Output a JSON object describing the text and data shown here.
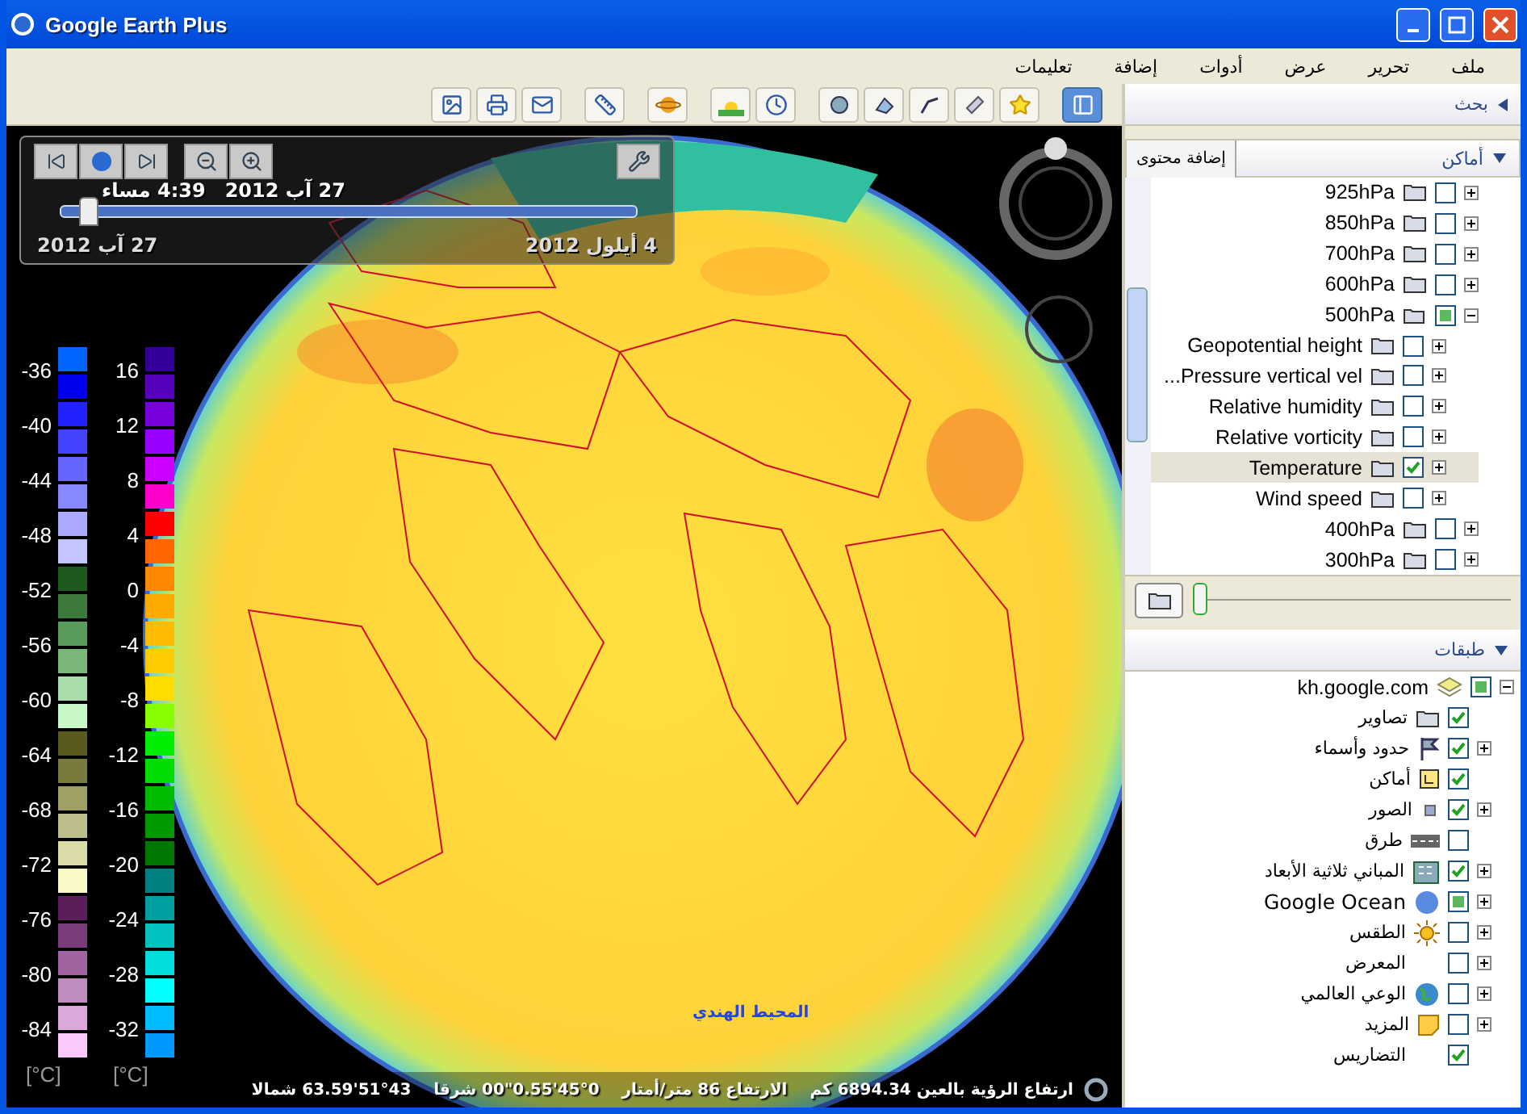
{
  "window": {
    "title": "Google Earth Plus"
  },
  "menu": [
    {
      "label": "ملف"
    },
    {
      "label": "تحرير"
    },
    {
      "label": "عرض"
    },
    {
      "label": "أدوات"
    },
    {
      "label": "إضافة"
    },
    {
      "label": "تعليمات"
    }
  ],
  "toolbar": {
    "sidebar_shown": true
  },
  "time_slider": {
    "time": "4:39 مساء",
    "date": "27 آب 2012",
    "start": "27 آب 2012",
    "end": "4 أيلول 2012",
    "level": 0.03
  },
  "legend": {
    "rows": [
      {
        "cells": [
          {
            "label": "16",
            "colors": [
              {
                "color": "#330099"
              },
              {
                "color": "#5500bb"
              }
            ]
          },
          {
            "label": "-36",
            "colors": [
              {
                "color": "#0066ff"
              },
              {
                "color": "#0000ee"
              }
            ]
          }
        ]
      },
      {
        "cells": [
          {
            "label": "12",
            "colors": [
              {
                "color": "#7700dd"
              },
              {
                "color": "#9900ff"
              }
            ]
          },
          {
            "label": "-40",
            "colors": [
              {
                "color": "#2222ff"
              },
              {
                "color": "#4444ff"
              }
            ]
          }
        ]
      },
      {
        "cells": [
          {
            "label": "8",
            "colors": [
              {
                "color": "#cc00ff"
              },
              {
                "color": "#ff00cc"
              }
            ]
          },
          {
            "label": "-44",
            "colors": [
              {
                "color": "#6666ff"
              },
              {
                "color": "#8888ff"
              }
            ]
          }
        ]
      },
      {
        "cells": [
          {
            "label": "4",
            "colors": [
              {
                "color": "#ff0000"
              },
              {
                "color": "#ff6600"
              }
            ]
          },
          {
            "label": "-48",
            "colors": [
              {
                "color": "#aaaaff"
              },
              {
                "color": "#c4c4ff"
              }
            ]
          }
        ]
      },
      {
        "cells": [
          {
            "label": "0",
            "colors": [
              {
                "color": "#ff8800"
              },
              {
                "color": "#ffaa00"
              }
            ]
          },
          {
            "label": "-52",
            "colors": [
              {
                "color": "#1e5a1e"
              },
              {
                "color": "#3c7a3c"
              }
            ]
          }
        ]
      },
      {
        "cells": [
          {
            "label": "-4",
            "colors": [
              {
                "color": "#ffbb00"
              },
              {
                "color": "#ffcc00"
              }
            ]
          },
          {
            "label": "-56",
            "colors": [
              {
                "color": "#5a9a5a"
              },
              {
                "color": "#7ab87a"
              }
            ]
          }
        ]
      },
      {
        "cells": [
          {
            "label": "-8",
            "colors": [
              {
                "color": "#ffdd00"
              },
              {
                "color": "#88ff00"
              }
            ]
          },
          {
            "label": "-60",
            "colors": [
              {
                "color": "#a8dca8"
              },
              {
                "color": "#c8f8c8"
              }
            ]
          }
        ]
      },
      {
        "cells": [
          {
            "label": "-12",
            "colors": [
              {
                "color": "#00ee00"
              },
              {
                "color": "#00dd00"
              }
            ]
          },
          {
            "label": "-64",
            "colors": [
              {
                "color": "#5a5a1e"
              },
              {
                "color": "#7a7a3c"
              }
            ]
          }
        ]
      },
      {
        "cells": [
          {
            "label": "-16",
            "colors": [
              {
                "color": "#00bb00"
              },
              {
                "color": "#009900"
              }
            ]
          },
          {
            "label": "-68",
            "colors": [
              {
                "color": "#a0a064"
              },
              {
                "color": "#bebe8c"
              }
            ]
          }
        ]
      },
      {
        "cells": [
          {
            "label": "-20",
            "colors": [
              {
                "color": "#007700"
              },
              {
                "color": "#008080"
              }
            ]
          },
          {
            "label": "-72",
            "colors": [
              {
                "color": "#dcdca8"
              },
              {
                "color": "#fafac8"
              }
            ]
          }
        ]
      },
      {
        "cells": [
          {
            "label": "-24",
            "colors": [
              {
                "color": "#00a0a0"
              },
              {
                "color": "#00c0c0"
              }
            ]
          },
          {
            "label": "-76",
            "colors": [
              {
                "color": "#5a1e5a"
              },
              {
                "color": "#7a3c7a"
              }
            ]
          }
        ]
      },
      {
        "cells": [
          {
            "label": "-28",
            "colors": [
              {
                "color": "#00dddd"
              },
              {
                "color": "#00ffff"
              }
            ]
          },
          {
            "label": "-80",
            "colors": [
              {
                "color": "#a064a0"
              },
              {
                "color": "#be8cbe"
              }
            ]
          }
        ]
      },
      {
        "cells": [
          {
            "label": "-32",
            "colors": [
              {
                "color": "#00bbff"
              },
              {
                "color": "#0099ff"
              }
            ]
          },
          {
            "label": "-84",
            "colors": [
              {
                "color": "#dca8dc"
              },
              {
                "color": "#fac8fa"
              }
            ]
          }
        ]
      }
    ],
    "units": [
      "[°C]",
      "[°C]"
    ]
  },
  "map_label": "المحيط الهندي",
  "status_bar": {
    "coordinates": "51°43'63.59 شمالا",
    "longitude": "45°0'0.55\"00 شرقا",
    "elevation": "الارتفاع 86 متر/أمتار",
    "eye_altitude": "ارتفاع الرؤية بالعين 6894.34 كم"
  },
  "sidebar": {
    "search": {
      "title": "بحث"
    },
    "places": {
      "title": "أماكن",
      "add_button": "إضافة محتوى",
      "transparency": {
        "level": 0
      },
      "items": [
        {
          "label": "925hPa",
          "checked": false,
          "expanded": false,
          "selected": false
        },
        {
          "label": "850hPa",
          "checked": false,
          "expanded": false,
          "selected": false
        },
        {
          "label": "700hPa",
          "checked": false,
          "expanded": false,
          "selected": false
        },
        {
          "label": "600hPa",
          "checked": false,
          "expanded": false,
          "selected": false
        },
        {
          "label": "500hPa",
          "partial": true,
          "expanded": true,
          "selected": false,
          "children": [
            {
              "label": "Geopotential height",
              "checked": false,
              "expanded": false,
              "selected": false
            },
            {
              "label": "Pressure vertical vel...",
              "checked": false,
              "expanded": false,
              "selected": false
            },
            {
              "label": "Relative humidity",
              "checked": false,
              "expanded": false,
              "selected": false
            },
            {
              "label": "Relative vorticity",
              "checked": false,
              "expanded": false,
              "selected": false
            },
            {
              "label": "Temperature",
              "checked": true,
              "expanded": false,
              "selected": true
            },
            {
              "label": "Wind speed",
              "checked": false,
              "expanded": false,
              "selected": false
            }
          ]
        },
        {
          "label": "400hPa",
          "checked": false,
          "expanded": false,
          "selected": false
        },
        {
          "label": "300hPa",
          "checked": false,
          "expanded": false,
          "selected": false
        }
      ]
    },
    "layers": {
      "title": "طبقات",
      "root": {
        "label": "kh.google.com",
        "partial": true,
        "expanded": true
      },
      "items": [
        {
          "label": "تصاوير",
          "checked": true,
          "expandable": false
        },
        {
          "label": "حدود وأسماء",
          "checked": true,
          "expandable": true
        },
        {
          "label": "أماكن",
          "checked": true,
          "expandable": false
        },
        {
          "label": "الصور",
          "checked": true,
          "expandable": true
        },
        {
          "label": "طرق",
          "checked": false,
          "expandable": false
        },
        {
          "label": "المباني ثلاثية الأبعاد",
          "checked": true,
          "expandable": true
        },
        {
          "label": "Google Ocean",
          "partial": true,
          "expandable": true
        },
        {
          "label": "الطقس",
          "checked": false,
          "expandable": true
        },
        {
          "label": "المعرض",
          "checked": false,
          "expandable": true
        },
        {
          "label": "الوعي العالمي",
          "checked": false,
          "expandable": true
        },
        {
          "label": "المزيد",
          "checked": false,
          "expandable": true
        },
        {
          "label": "التضاريس",
          "checked": true,
          "expandable": false
        }
      ]
    }
  }
}
